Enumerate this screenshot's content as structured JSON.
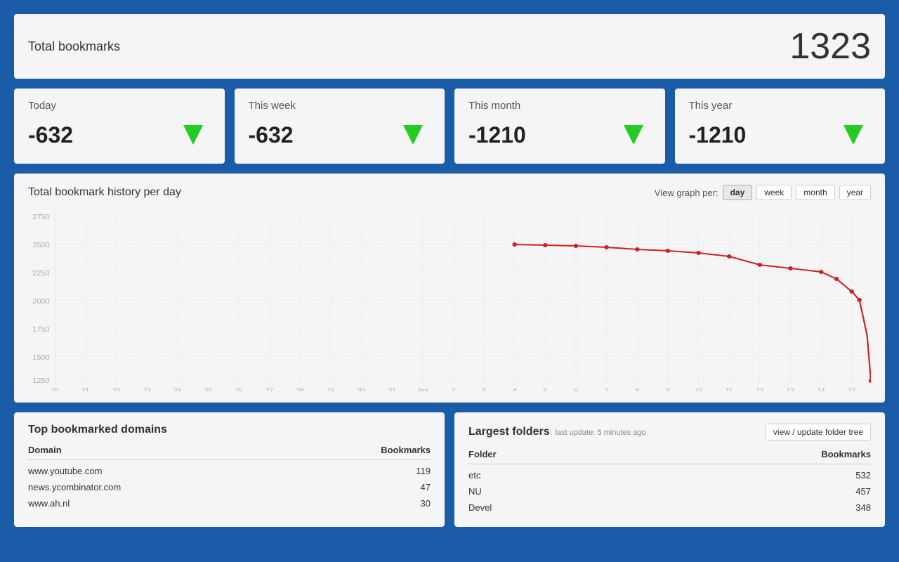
{
  "total": {
    "label": "Total bookmarks",
    "value": "1323"
  },
  "stats": [
    {
      "label": "Today",
      "value": "-632"
    },
    {
      "label": "This week",
      "value": "-632"
    },
    {
      "label": "This month",
      "value": "-1210"
    },
    {
      "label": "This year",
      "value": "-1210"
    }
  ],
  "graph": {
    "title": "Total bookmark history per day",
    "view_label": "View graph per:",
    "buttons": [
      "day",
      "week",
      "month",
      "year"
    ],
    "active_button": "day"
  },
  "domains": {
    "title": "Top bookmarked domains",
    "col_domain": "Domain",
    "col_bookmarks": "Bookmarks",
    "rows": [
      {
        "domain": "www.youtube.com",
        "count": "119"
      },
      {
        "domain": "news.ycombinator.com",
        "count": "47"
      },
      {
        "domain": "www.ah.nl",
        "count": "30"
      }
    ]
  },
  "folders": {
    "title": "Largest folders",
    "last_update": "last update: 5 minutes ago",
    "view_btn": "view / update folder tree",
    "col_folder": "Folder",
    "col_bookmarks": "Bookmarks",
    "rows": [
      {
        "folder": "etc",
        "count": "532"
      },
      {
        "folder": "NU",
        "count": "457"
      },
      {
        "folder": "Devel",
        "count": "348"
      }
    ]
  }
}
